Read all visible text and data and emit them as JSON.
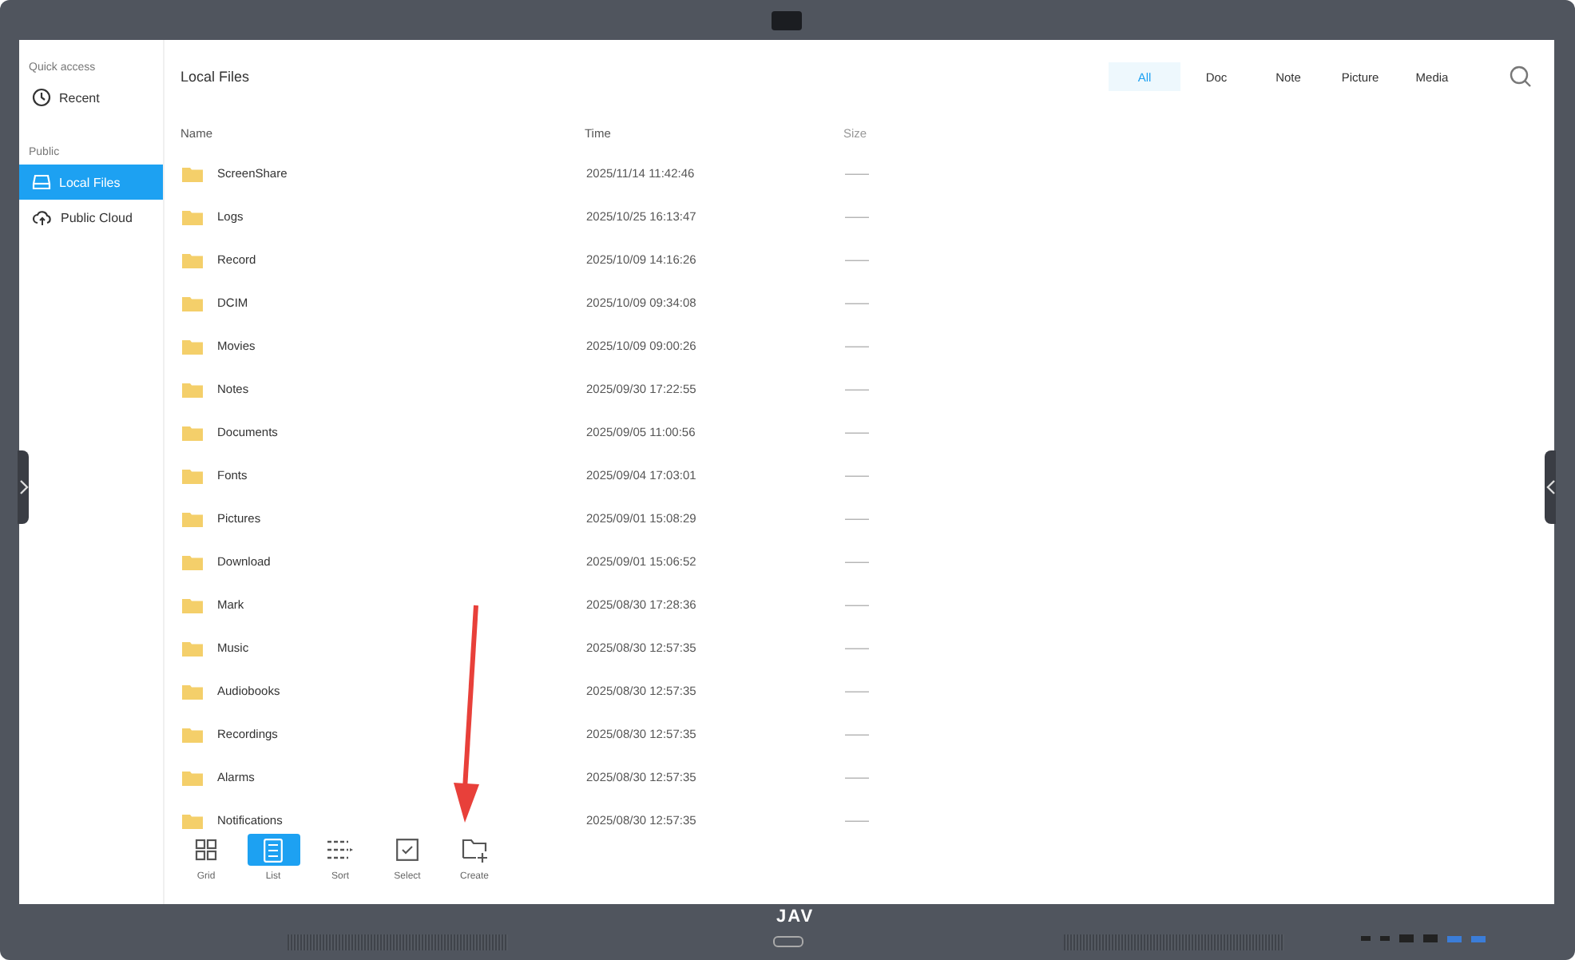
{
  "brand": "JAV",
  "sidebar": {
    "sections": [
      {
        "heading": "Quick access",
        "items": [
          {
            "label": "Recent",
            "kind": "clock",
            "selected": false
          }
        ]
      },
      {
        "heading": "Public",
        "items": [
          {
            "label": "Local Files",
            "kind": "drive",
            "selected": true
          },
          {
            "label": "Public Cloud",
            "kind": "cloud",
            "selected": false
          }
        ]
      }
    ]
  },
  "title": "Local Files",
  "filters": [
    {
      "label": "All",
      "selected": true
    },
    {
      "label": "Doc",
      "selected": false
    },
    {
      "label": "Note",
      "selected": false
    },
    {
      "label": "Picture",
      "selected": false
    },
    {
      "label": "Media",
      "selected": false
    }
  ],
  "table": {
    "columns": [
      "Name",
      "Time",
      "Size"
    ],
    "rows": [
      {
        "name": "ScreenShare",
        "time": "2025/11/14 11:42:46",
        "size": "——"
      },
      {
        "name": "Logs",
        "time": "2025/10/25 16:13:47",
        "size": "——"
      },
      {
        "name": "Record",
        "time": "2025/10/09 14:16:26",
        "size": "——"
      },
      {
        "name": "DCIM",
        "time": "2025/10/09 09:34:08",
        "size": "——"
      },
      {
        "name": "Movies",
        "time": "2025/10/09 09:00:26",
        "size": "——"
      },
      {
        "name": "Notes",
        "time": "2025/09/30 17:22:55",
        "size": "——"
      },
      {
        "name": "Documents",
        "time": "2025/09/05 11:00:56",
        "size": "——"
      },
      {
        "name": "Fonts",
        "time": "2025/09/04 17:03:01",
        "size": "——"
      },
      {
        "name": "Pictures",
        "time": "2025/09/01 15:08:29",
        "size": "——"
      },
      {
        "name": "Download",
        "time": "2025/09/01 15:06:52",
        "size": "——"
      },
      {
        "name": "Mark",
        "time": "2025/08/30 17:28:36",
        "size": "——"
      },
      {
        "name": "Music",
        "time": "2025/08/30 12:57:35",
        "size": "——"
      },
      {
        "name": "Audiobooks",
        "time": "2025/08/30 12:57:35",
        "size": "——"
      },
      {
        "name": "Recordings",
        "time": "2025/08/30 12:57:35",
        "size": "——"
      },
      {
        "name": "Alarms",
        "time": "2025/08/30 12:57:35",
        "size": "——"
      },
      {
        "name": "Notifications",
        "time": "2025/08/30 12:57:35",
        "size": "——"
      }
    ]
  },
  "toolbar": [
    {
      "label": "Grid",
      "kind": "grid",
      "selected": false
    },
    {
      "label": "List",
      "kind": "list",
      "selected": true
    },
    {
      "label": "Sort",
      "kind": "sort",
      "selected": false
    },
    {
      "label": "Select",
      "kind": "select",
      "selected": false
    },
    {
      "label": "Create",
      "kind": "create",
      "selected": false
    }
  ]
}
